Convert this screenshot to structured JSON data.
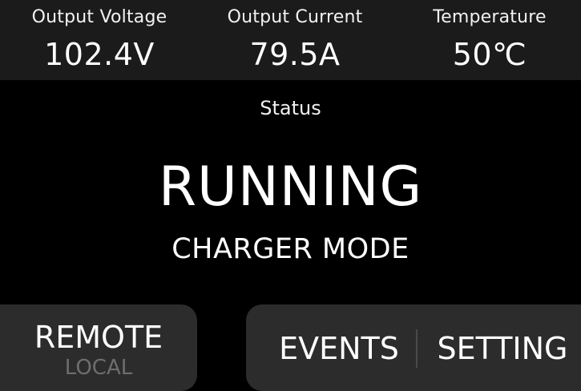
{
  "metrics": {
    "voltage": {
      "label": "Output Voltage",
      "value": "102.4V"
    },
    "current": {
      "label": "Output Current",
      "value": "79.5A"
    },
    "temperature": {
      "label": "Temperature",
      "value": "50℃"
    }
  },
  "status": {
    "label": "Status",
    "value": "RUNNING",
    "mode": "CHARGER MODE"
  },
  "control": {
    "primary": "REMOTE",
    "secondary": "LOCAL"
  },
  "nav": {
    "events": "EVENTS",
    "setting": "SETTING"
  },
  "colors": {
    "background": "#000000",
    "top_bar": "#1b1b1b",
    "panel": "#2c2c2c",
    "text": "#ffffff",
    "inactive_text": "#6e6e6e"
  }
}
